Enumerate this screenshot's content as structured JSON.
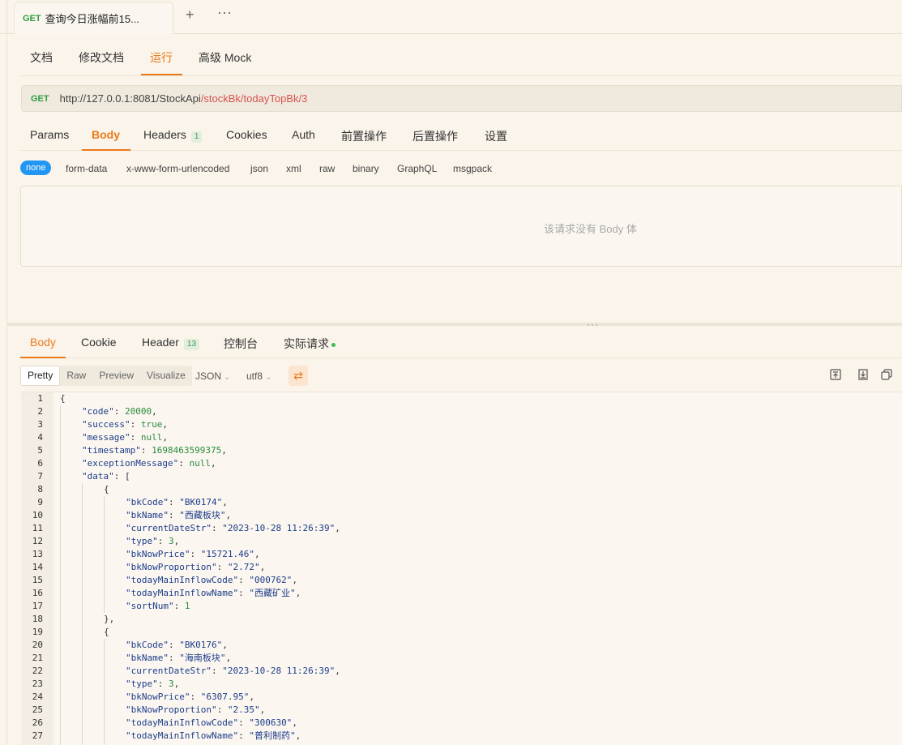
{
  "tab": {
    "method": "GET",
    "title": "查询今日涨幅前15..."
  },
  "subtabs": [
    "文档",
    "修改文档",
    "运行",
    "高级 Mock"
  ],
  "url": {
    "method": "GET",
    "base": "http://127.0.0.1:8081/StockApi",
    "path": "/stockBk/todayTopBk/3"
  },
  "request_tabs": {
    "params": "Params",
    "body": "Body",
    "headers": "Headers",
    "headers_count": "1",
    "cookies": "Cookies",
    "auth": "Auth",
    "pre": "前置操作",
    "post": "后置操作",
    "settings": "设置"
  },
  "body_types": [
    "none",
    "form-data",
    "x-www-form-urlencoded",
    "json",
    "xml",
    "raw",
    "binary",
    "GraphQL",
    "msgpack"
  ],
  "empty_body": "该请求没有 Body 体",
  "response_tabs": {
    "body": "Body",
    "cookie": "Cookie",
    "header": "Header",
    "header_count": "13",
    "console": "控制台",
    "actual": "实际请求"
  },
  "format_modes": [
    "Pretty",
    "Raw",
    "Preview",
    "Visualize"
  ],
  "format_type": "JSON",
  "encoding": "utf8",
  "code_lines": [
    {
      "n": "1",
      "indent": 0,
      "parts": [
        [
          "p",
          "{"
        ]
      ]
    },
    {
      "n": "2",
      "indent": 1,
      "parts": [
        [
          "k",
          "\"code\""
        ],
        [
          "p",
          ": "
        ],
        [
          "n",
          "20000"
        ],
        [
          "p",
          ","
        ]
      ]
    },
    {
      "n": "3",
      "indent": 1,
      "parts": [
        [
          "k",
          "\"success\""
        ],
        [
          "p",
          ": "
        ],
        [
          "b",
          "true"
        ],
        [
          "p",
          ","
        ]
      ]
    },
    {
      "n": "4",
      "indent": 1,
      "parts": [
        [
          "k",
          "\"message\""
        ],
        [
          "p",
          ": "
        ],
        [
          "b",
          "null"
        ],
        [
          "p",
          ","
        ]
      ]
    },
    {
      "n": "5",
      "indent": 1,
      "parts": [
        [
          "k",
          "\"timestamp\""
        ],
        [
          "p",
          ": "
        ],
        [
          "n",
          "1698463599375"
        ],
        [
          "p",
          ","
        ]
      ]
    },
    {
      "n": "6",
      "indent": 1,
      "parts": [
        [
          "k",
          "\"exceptionMessage\""
        ],
        [
          "p",
          ": "
        ],
        [
          "b",
          "null"
        ],
        [
          "p",
          ","
        ]
      ]
    },
    {
      "n": "7",
      "indent": 1,
      "parts": [
        [
          "k",
          "\"data\""
        ],
        [
          "p",
          ": ["
        ]
      ]
    },
    {
      "n": "8",
      "indent": 2,
      "parts": [
        [
          "p",
          "{"
        ]
      ]
    },
    {
      "n": "9",
      "indent": 3,
      "parts": [
        [
          "k",
          "\"bkCode\""
        ],
        [
          "p",
          ": "
        ],
        [
          "s",
          "\"BK0174\""
        ],
        [
          "p",
          ","
        ]
      ]
    },
    {
      "n": "10",
      "indent": 3,
      "parts": [
        [
          "k",
          "\"bkName\""
        ],
        [
          "p",
          ": "
        ],
        [
          "s",
          "\"西藏板块\""
        ],
        [
          "p",
          ","
        ]
      ]
    },
    {
      "n": "11",
      "indent": 3,
      "parts": [
        [
          "k",
          "\"currentDateStr\""
        ],
        [
          "p",
          ": "
        ],
        [
          "s",
          "\"2023-10-28 11:26:39\""
        ],
        [
          "p",
          ","
        ]
      ]
    },
    {
      "n": "12",
      "indent": 3,
      "parts": [
        [
          "k",
          "\"type\""
        ],
        [
          "p",
          ": "
        ],
        [
          "n",
          "3"
        ],
        [
          "p",
          ","
        ]
      ]
    },
    {
      "n": "13",
      "indent": 3,
      "parts": [
        [
          "k",
          "\"bkNowPrice\""
        ],
        [
          "p",
          ": "
        ],
        [
          "s",
          "\"15721.46\""
        ],
        [
          "p",
          ","
        ]
      ]
    },
    {
      "n": "14",
      "indent": 3,
      "parts": [
        [
          "k",
          "\"bkNowProportion\""
        ],
        [
          "p",
          ": "
        ],
        [
          "s",
          "\"2.72\""
        ],
        [
          "p",
          ","
        ]
      ]
    },
    {
      "n": "15",
      "indent": 3,
      "parts": [
        [
          "k",
          "\"todayMainInflowCode\""
        ],
        [
          "p",
          ": "
        ],
        [
          "s",
          "\"000762\""
        ],
        [
          "p",
          ","
        ]
      ]
    },
    {
      "n": "16",
      "indent": 3,
      "parts": [
        [
          "k",
          "\"todayMainInflowName\""
        ],
        [
          "p",
          ": "
        ],
        [
          "s",
          "\"西藏矿业\""
        ],
        [
          "p",
          ","
        ]
      ]
    },
    {
      "n": "17",
      "indent": 3,
      "parts": [
        [
          "k",
          "\"sortNum\""
        ],
        [
          "p",
          ": "
        ],
        [
          "n",
          "1"
        ]
      ]
    },
    {
      "n": "18",
      "indent": 2,
      "parts": [
        [
          "p",
          "},"
        ]
      ]
    },
    {
      "n": "19",
      "indent": 2,
      "parts": [
        [
          "p",
          "{"
        ]
      ]
    },
    {
      "n": "20",
      "indent": 3,
      "parts": [
        [
          "k",
          "\"bkCode\""
        ],
        [
          "p",
          ": "
        ],
        [
          "s",
          "\"BK0176\""
        ],
        [
          "p",
          ","
        ]
      ]
    },
    {
      "n": "21",
      "indent": 3,
      "parts": [
        [
          "k",
          "\"bkName\""
        ],
        [
          "p",
          ": "
        ],
        [
          "s",
          "\"海南板块\""
        ],
        [
          "p",
          ","
        ]
      ]
    },
    {
      "n": "22",
      "indent": 3,
      "parts": [
        [
          "k",
          "\"currentDateStr\""
        ],
        [
          "p",
          ": "
        ],
        [
          "s",
          "\"2023-10-28 11:26:39\""
        ],
        [
          "p",
          ","
        ]
      ]
    },
    {
      "n": "23",
      "indent": 3,
      "parts": [
        [
          "k",
          "\"type\""
        ],
        [
          "p",
          ": "
        ],
        [
          "n",
          "3"
        ],
        [
          "p",
          ","
        ]
      ]
    },
    {
      "n": "24",
      "indent": 3,
      "parts": [
        [
          "k",
          "\"bkNowPrice\""
        ],
        [
          "p",
          ": "
        ],
        [
          "s",
          "\"6307.95\""
        ],
        [
          "p",
          ","
        ]
      ]
    },
    {
      "n": "25",
      "indent": 3,
      "parts": [
        [
          "k",
          "\"bkNowProportion\""
        ],
        [
          "p",
          ": "
        ],
        [
          "s",
          "\"2.35\""
        ],
        [
          "p",
          ","
        ]
      ]
    },
    {
      "n": "26",
      "indent": 3,
      "parts": [
        [
          "k",
          "\"todayMainInflowCode\""
        ],
        [
          "p",
          ": "
        ],
        [
          "s",
          "\"300630\""
        ],
        [
          "p",
          ","
        ]
      ]
    },
    {
      "n": "27",
      "indent": 3,
      "parts": [
        [
          "k",
          "\"todayMainInflowName\""
        ],
        [
          "p",
          ": "
        ],
        [
          "s",
          "\"普利制药\""
        ],
        [
          "p",
          ","
        ]
      ]
    }
  ]
}
